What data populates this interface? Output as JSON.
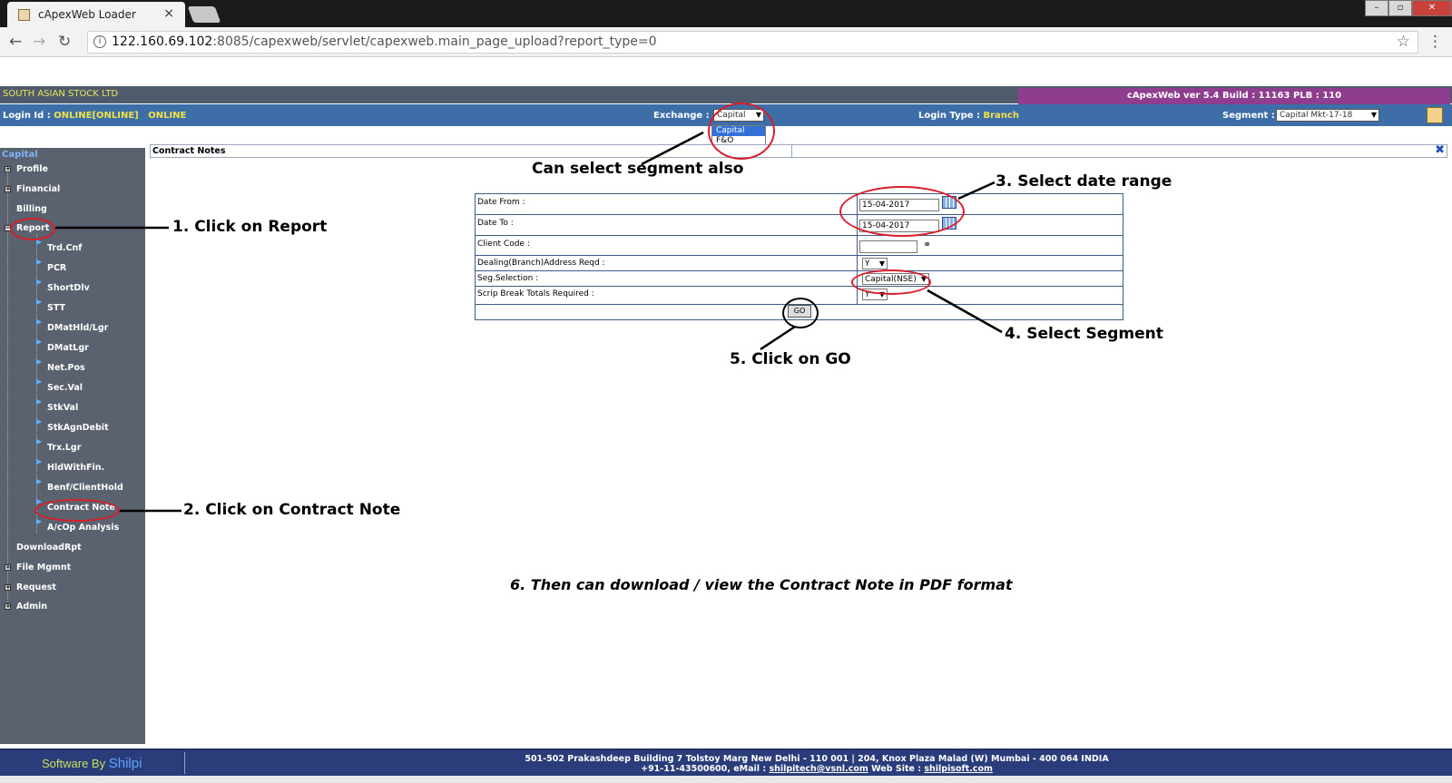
{
  "browser": {
    "tab_title": "cApexWeb Loader",
    "tab_close": "×",
    "url_host": "122.160.69.102",
    "url_rest": ":8085/capexweb/servlet/capexweb.main_page_upload?report_type=0",
    "nav_back": "←",
    "nav_forward": "→",
    "nav_reload": "↻",
    "star": "☆",
    "menu": "⋮"
  },
  "header": {
    "company": "SOUTH ASIAN STOCK LTD",
    "version_info": "cApexWeb ver 5.4 Build : 11163  PLB : 110",
    "login_id_label": "Login Id :",
    "login_id_value": "ONLINE[ONLINE]",
    "login_id_extra": "ONLINE",
    "exchange_label": "Exchange :",
    "exchange_value": "Capital",
    "exchange_options": [
      "Capital",
      "F&O"
    ],
    "login_type_label": "Login Type :",
    "login_type_value": "Branch",
    "segment_label": "Segment :",
    "segment_value": "Capital Mkt-17-18"
  },
  "sidebar": {
    "root": "Capital",
    "top_items": [
      "Profile",
      "Financial",
      "Billing",
      "Report"
    ],
    "report_items": [
      "Trd.Cnf",
      "PCR",
      "ShortDlv",
      "STT",
      "DMatHld/Lgr",
      "DMatLgr",
      "Net.Pos",
      "Sec.Val",
      "StkVal",
      "StkAgnDebit",
      "Trx.Lgr",
      "HldWithFin.",
      "Benf/ClientHold",
      "Contract Note",
      "A/cOp Analysis"
    ],
    "bottom_items": [
      "DownloadRpt",
      "File Mgmnt",
      "Request",
      "Admin"
    ]
  },
  "content": {
    "title": "Contract Notes",
    "close_icon": "✖"
  },
  "form": {
    "date_from_label": "Date From :",
    "date_from_value": "15-04-2017",
    "date_to_label": "Date To :",
    "date_to_value": "15-04-2017",
    "client_code_label": "Client Code :",
    "client_code_value": "",
    "dealing_label": "Dealing(Branch)Address Reqd :",
    "dealing_value": "Y",
    "seg_label": "Seg.Selection :",
    "seg_value": "Capital(NSE)",
    "scrip_label": "Scrip Break Totals Required :",
    "scrip_value": "Y",
    "go_label": "GO"
  },
  "annotations": {
    "segment_note": "Can select segment also",
    "step1": "1. Click on Report",
    "step2": "2. Click on Contract Note",
    "step3": "3. Select date range",
    "step4": "4. Select Segment",
    "step5": "5. Click on GO",
    "step6": "6. Then can download / view the Contract Note in PDF format"
  },
  "footer": {
    "software_by": "Software By",
    "brand": "Shilpi",
    "address_line1": "501-502 Prakashdeep Building 7 Tolstoy Marg New Delhi - 110 001   |    204, Knox Plaza Malad (W) Mumbai - 400 064 INDIA",
    "phone": "+91-11-43500600, eMail :",
    "email": "shilpitech@vsnl.com",
    "website_label": "Web Site :",
    "website": "shilpisoft.com"
  },
  "colors": {
    "header_top": "#4f5a6a",
    "header_blue": "#3d6ea8",
    "version_bar": "#8e3d8f",
    "sidebar": "#5a6270",
    "footer": "#2a3d7a",
    "annotation_ring": "#d81e2a"
  }
}
